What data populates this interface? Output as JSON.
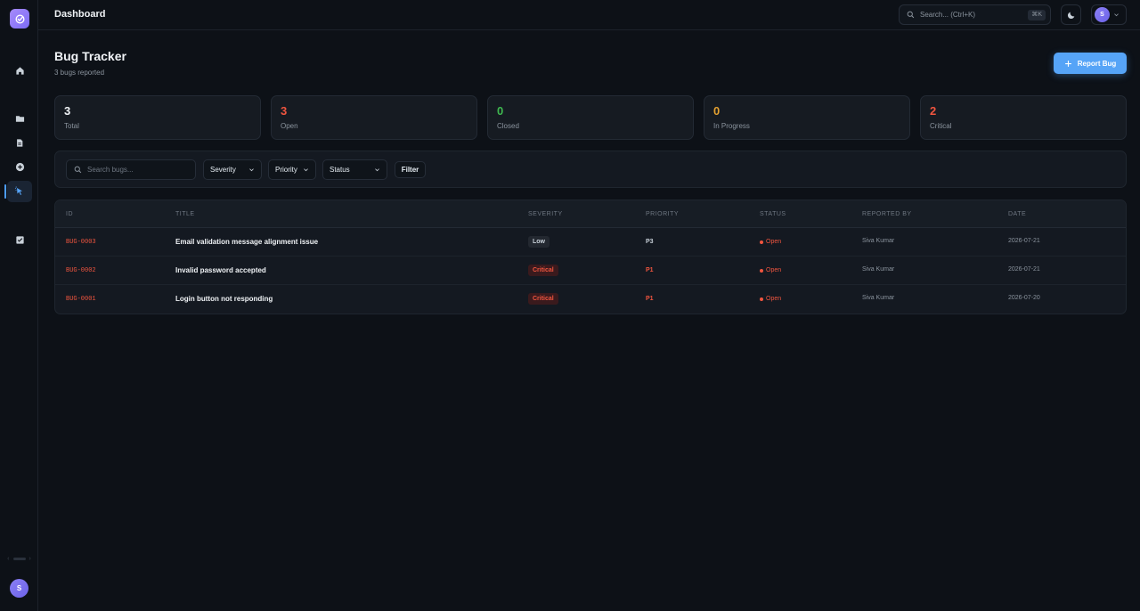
{
  "header": {
    "title": "Dashboard",
    "search_placeholder": "Search... (Ctrl+K)",
    "search_shortcut": "⌘K",
    "user_initial": "S"
  },
  "sidebar": {
    "items": [
      {
        "name": "home-icon"
      },
      {
        "name": "folder-icon"
      },
      {
        "name": "document-icon"
      },
      {
        "name": "add-circle-icon"
      },
      {
        "name": "bug-tracker-icon",
        "active": true
      },
      {
        "name": "checklist-icon"
      }
    ],
    "user_initial": "S"
  },
  "page": {
    "title": "Bug Tracker",
    "subtitle": "3 bugs reported",
    "report_button": "Report Bug"
  },
  "stats": [
    {
      "value": "3",
      "label": "Total",
      "color": "#f0f3f6"
    },
    {
      "value": "3",
      "label": "Open",
      "color": "#f0553f"
    },
    {
      "value": "0",
      "label": "Closed",
      "color": "#3fb950"
    },
    {
      "value": "0",
      "label": "In Progress",
      "color": "#e3a030"
    },
    {
      "value": "2",
      "label": "Critical",
      "color": "#f0553f"
    }
  ],
  "filters": {
    "search_placeholder": "Search bugs...",
    "severity": "Severity",
    "priority": "Priority",
    "status": "Status",
    "filter_button": "Filter"
  },
  "table": {
    "columns": [
      "ID",
      "TITLE",
      "SEVERITY",
      "PRIORITY",
      "STATUS",
      "REPORTED BY",
      "DATE"
    ],
    "rows": [
      {
        "id": "BUG-0003",
        "title": "Email validation message alignment issue",
        "severity": "Low",
        "priority": "P3",
        "status": "Open",
        "reporter": "Siva Kumar",
        "date": "2026-07-21"
      },
      {
        "id": "BUG-0002",
        "title": "Invalid password accepted",
        "severity": "Critical",
        "priority": "P1",
        "status": "Open",
        "reporter": "Siva Kumar",
        "date": "2026-07-21"
      },
      {
        "id": "BUG-0001",
        "title": "Login button not responding",
        "severity": "Critical",
        "priority": "P1",
        "status": "Open",
        "reporter": "Siva Kumar",
        "date": "2026-07-20"
      }
    ]
  },
  "colors": {
    "accent": "#56a4f7",
    "danger": "#f0553f",
    "success": "#3fb950",
    "warning": "#e3a030"
  }
}
